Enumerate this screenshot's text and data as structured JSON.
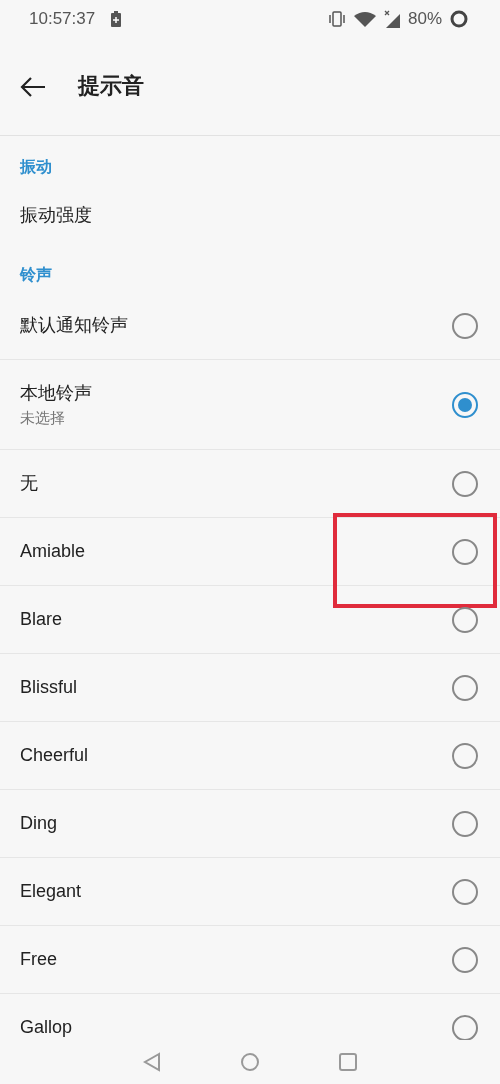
{
  "status_bar": {
    "time": "10:57:37",
    "battery": "80%"
  },
  "app_bar": {
    "title": "提示音"
  },
  "sections": [
    {
      "header": "振动",
      "items": [
        {
          "kind": "plain",
          "title": "振动强度"
        }
      ]
    },
    {
      "header": "铃声",
      "items": [
        {
          "kind": "radio",
          "title": "默认通知铃声",
          "selected": false,
          "highlighted": false
        },
        {
          "kind": "radio",
          "title": "本地铃声",
          "subtitle": "未选择",
          "selected": true,
          "highlighted": false
        },
        {
          "kind": "radio",
          "title": "无",
          "selected": false,
          "highlighted": false
        },
        {
          "kind": "radio",
          "title": "Amiable",
          "selected": false,
          "highlighted": true
        },
        {
          "kind": "radio",
          "title": "Blare",
          "selected": false,
          "highlighted": false
        },
        {
          "kind": "radio",
          "title": "Blissful",
          "selected": false,
          "highlighted": false
        },
        {
          "kind": "radio",
          "title": "Cheerful",
          "selected": false,
          "highlighted": false
        },
        {
          "kind": "radio",
          "title": "Ding",
          "selected": false,
          "highlighted": false
        },
        {
          "kind": "radio",
          "title": "Elegant",
          "selected": false,
          "highlighted": false
        },
        {
          "kind": "radio",
          "title": "Free",
          "selected": false,
          "highlighted": false
        },
        {
          "kind": "radio",
          "title": "Gallop",
          "selected": false,
          "highlighted": false
        }
      ]
    }
  ]
}
